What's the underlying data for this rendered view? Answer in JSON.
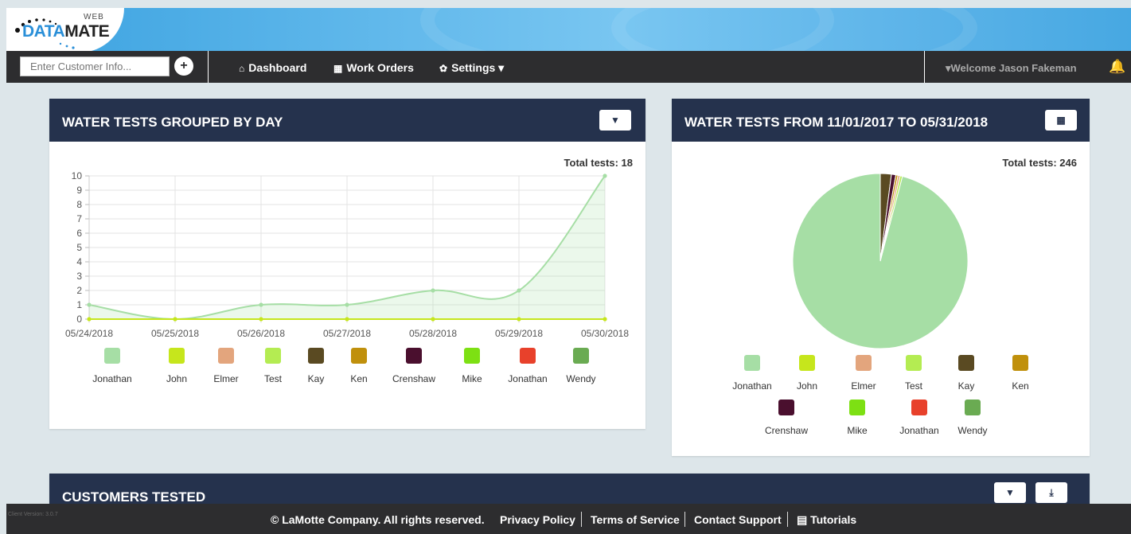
{
  "brand": {
    "web": "WEB",
    "name_a": "DATA",
    "name_b": "MATE"
  },
  "nav": {
    "search_placeholder": "Enter Customer Info...",
    "add_customer_icon": "+",
    "links": [
      {
        "icon": "⌂",
        "label": "Dashboard"
      },
      {
        "icon": "▦",
        "label": "Work Orders"
      },
      {
        "icon": "✿",
        "label": "Settings ▾"
      }
    ],
    "welcome": "▾Welcome Jason Fakeman",
    "bell_icon": "🔔"
  },
  "colors": {
    "header": "#25324d",
    "area_line": "#a6dea5",
    "baseline": "#c6e61c"
  },
  "panel_left": {
    "title": "WATER TESTS GROUPED BY DAY",
    "filter_icon": "▼",
    "total": "Total tests: 18",
    "chart_data": {
      "type": "area",
      "categories": [
        "05/24/2018",
        "05/25/2018",
        "05/26/2018",
        "05/27/2018",
        "05/28/2018",
        "05/29/2018",
        "05/30/2018"
      ],
      "series": [
        {
          "name": "Jonathan",
          "values": [
            1,
            0,
            1,
            1,
            2,
            2,
            10
          ],
          "color": "#a6dea5"
        },
        {
          "name": "John",
          "values": [
            0,
            0,
            0,
            0,
            0,
            0,
            0
          ],
          "color": "#c6e61c"
        }
      ],
      "yticks": [
        "0",
        "1",
        "2",
        "3",
        "4",
        "5",
        "6",
        "7",
        "8",
        "9",
        "10"
      ],
      "ylim": [
        0,
        10
      ],
      "grid": true
    },
    "legend": [
      {
        "name": "Jonathan",
        "color": "#a6dea5"
      },
      {
        "name": "John",
        "color": "#c6e61c"
      },
      {
        "name": "Elmer",
        "color": "#e3a57d"
      },
      {
        "name": "Test",
        "color": "#b4ec52"
      },
      {
        "name": "Kay",
        "color": "#5a4a22"
      },
      {
        "name": "Ken",
        "color": "#c0900c"
      },
      {
        "name": "Crenshaw",
        "color": "#4a0f2e"
      },
      {
        "name": "Mike",
        "color": "#7de013"
      },
      {
        "name": "Jonathan",
        "color": "#e8412b"
      },
      {
        "name": "Wendy",
        "color": "#6aab52"
      }
    ]
  },
  "panel_right": {
    "title": "WATER TESTS FROM 11/01/2017 TO 05/31/2018",
    "calendar_icon": "▦",
    "total": "Total tests: 246",
    "chart_data": {
      "type": "pie",
      "slices": [
        {
          "name": "Jonathan",
          "value": 236,
          "color": "#a6dea5"
        },
        {
          "name": "Kay",
          "value": 5,
          "color": "#5a4a22"
        },
        {
          "name": "Crenshaw",
          "value": 2,
          "color": "#4a0f2e"
        },
        {
          "name": "Ken",
          "value": 1,
          "color": "#c0900c"
        },
        {
          "name": "Elmer",
          "value": 1,
          "color": "#e3a57d"
        },
        {
          "name": "Test",
          "value": 1,
          "color": "#b4ec52"
        }
      ]
    },
    "legend": [
      {
        "name": "Jonathan",
        "color": "#a6dea5"
      },
      {
        "name": "John",
        "color": "#c6e61c"
      },
      {
        "name": "Elmer",
        "color": "#e3a57d"
      },
      {
        "name": "Test",
        "color": "#b4ec52"
      },
      {
        "name": "Kay",
        "color": "#5a4a22"
      },
      {
        "name": "Ken",
        "color": "#c0900c"
      },
      {
        "name": "Crenshaw",
        "color": "#4a0f2e"
      },
      {
        "name": "Mike",
        "color": "#7de013"
      },
      {
        "name": "Jonathan",
        "color": "#e8412b"
      },
      {
        "name": "Wendy",
        "color": "#6aab52"
      }
    ]
  },
  "panel_customers": {
    "title": "CUSTOMERS TESTED",
    "filter_icon": "▼",
    "export_icon": "⤓"
  },
  "footer": {
    "version": "Client Version: 3.0.7",
    "copyright": "© LaMotte Company. All rights reserved.",
    "privacy": "Privacy Policy",
    "terms": "Terms of Service",
    "support": "Contact Support",
    "tutorials": "▤ Tutorials"
  }
}
